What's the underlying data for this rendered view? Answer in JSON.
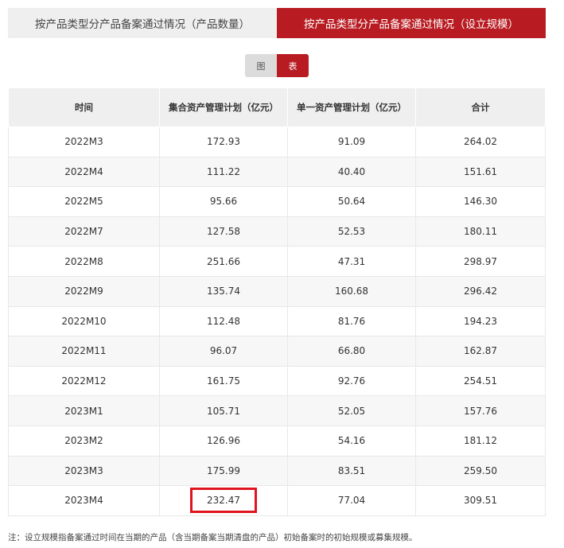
{
  "tabs": [
    {
      "label": "按产品类型分产品备案通过情况（产品数量）",
      "active": false
    },
    {
      "label": "按产品类型分产品备案通过情况（设立规模）",
      "active": true
    }
  ],
  "view_toggle": {
    "chart_label": "图",
    "table_label": "表",
    "selected": "表"
  },
  "table": {
    "headers": [
      "时间",
      "集合资产管理计划（亿元）",
      "单一资产管理计划（亿元）",
      "合计"
    ],
    "rows": [
      [
        "2022M3",
        "172.93",
        "91.09",
        "264.02"
      ],
      [
        "2022M4",
        "111.22",
        "40.40",
        "151.61"
      ],
      [
        "2022M5",
        "95.66",
        "50.64",
        "146.30"
      ],
      [
        "2022M7",
        "127.58",
        "52.53",
        "180.11"
      ],
      [
        "2022M8",
        "251.66",
        "47.31",
        "298.97"
      ],
      [
        "2022M9",
        "135.74",
        "160.68",
        "296.42"
      ],
      [
        "2022M10",
        "112.48",
        "81.76",
        "194.23"
      ],
      [
        "2022M11",
        "96.07",
        "66.80",
        "162.87"
      ],
      [
        "2022M12",
        "161.75",
        "92.76",
        "254.51"
      ],
      [
        "2023M1",
        "105.71",
        "52.05",
        "157.76"
      ],
      [
        "2023M2",
        "126.96",
        "54.16",
        "181.12"
      ],
      [
        "2023M3",
        "175.99",
        "83.51",
        "259.50"
      ],
      [
        "2023M4",
        "232.47",
        "77.04",
        "309.51"
      ]
    ]
  },
  "highlight_color": "#e0141e",
  "accent_color": "#b81c22",
  "note": "注：设立规模指备案通过时间在当期的产品（含当期备案当期清盘的产品）初始备案时的初始规模或募集规模。"
}
